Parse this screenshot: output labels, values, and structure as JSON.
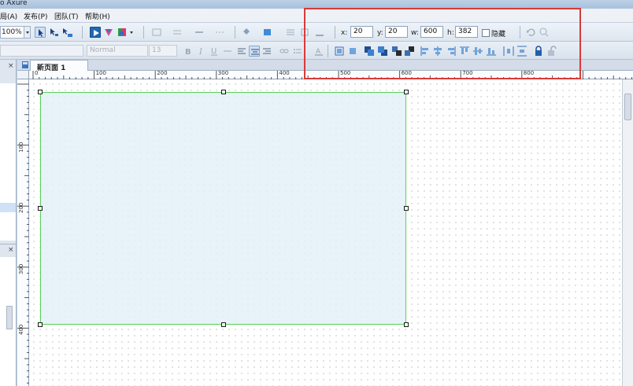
{
  "window": {
    "title": "o Axure"
  },
  "menu": [
    "局(A)",
    "发布(P)",
    "团队(T)",
    "帮助(H)"
  ],
  "toolbar": {
    "zoom_value": "100%",
    "font_name": "Normal",
    "font_size": "13",
    "coords": {
      "x_label": "x:",
      "x_value": "20",
      "y_label": "y:",
      "y_value": "20",
      "w_label": "w:",
      "w_value": "600",
      "h_label": "h:",
      "h_value": "382",
      "hidden_label": "隐藏",
      "hidden_checked": false
    }
  },
  "tabs": [
    {
      "label": "新页面 1",
      "close": "×"
    }
  ],
  "sidebar": {
    "close_glyphs": [
      "×",
      "×"
    ]
  },
  "rulers": {
    "horizontal": [
      "0",
      "100",
      "200",
      "300",
      "400",
      "500",
      "600",
      "700",
      "800"
    ],
    "vertical": [
      "100",
      "200",
      "300",
      "400"
    ]
  },
  "widget": {
    "type": "rectangle",
    "x": 20,
    "y": 20,
    "w": 600,
    "h": 382
  },
  "colors": {
    "highlight_border": "#d83a3a",
    "selection_border": "#57d157",
    "widget_fill": "#e2f0f6",
    "chrome": "#c6d2e1"
  }
}
